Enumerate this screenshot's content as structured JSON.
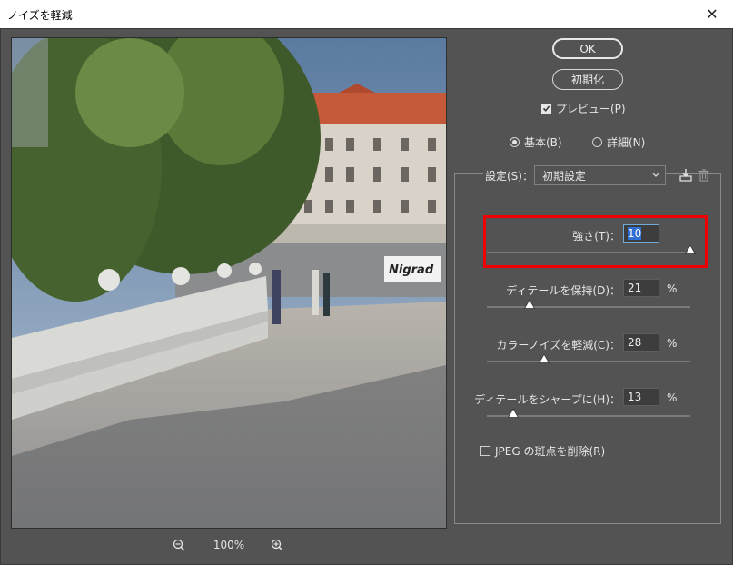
{
  "window": {
    "title": "ノイズを軽減",
    "close_glyph": "✕"
  },
  "preview": {
    "zoom": "100%"
  },
  "buttons": {
    "ok": "OK",
    "reset": "初期化"
  },
  "preview_toggle": {
    "label": "プレビュー(P)",
    "checked": true
  },
  "mode": {
    "basic": "基本(B)",
    "advanced": "詳細(N)",
    "selected": "basic"
  },
  "settings": {
    "label": "設定(S)：",
    "value": "初期設定"
  },
  "sliders": [
    {
      "label": "強さ(T)：",
      "value": "10",
      "max": 10,
      "unit": ""
    },
    {
      "label": "ディテールを保持(D)：",
      "value": "21",
      "max": 100,
      "unit": "%"
    },
    {
      "label": "カラーノイズを軽減(C)：",
      "value": "28",
      "max": 100,
      "unit": "%"
    },
    {
      "label": "ディテールをシャープに(H)：",
      "value": "13",
      "max": 100,
      "unit": "%"
    }
  ],
  "jpeg": {
    "label": "JPEG の斑点を削除(R)",
    "checked": false
  },
  "colors": {
    "highlight": "#f00000",
    "panel": "#535353"
  }
}
